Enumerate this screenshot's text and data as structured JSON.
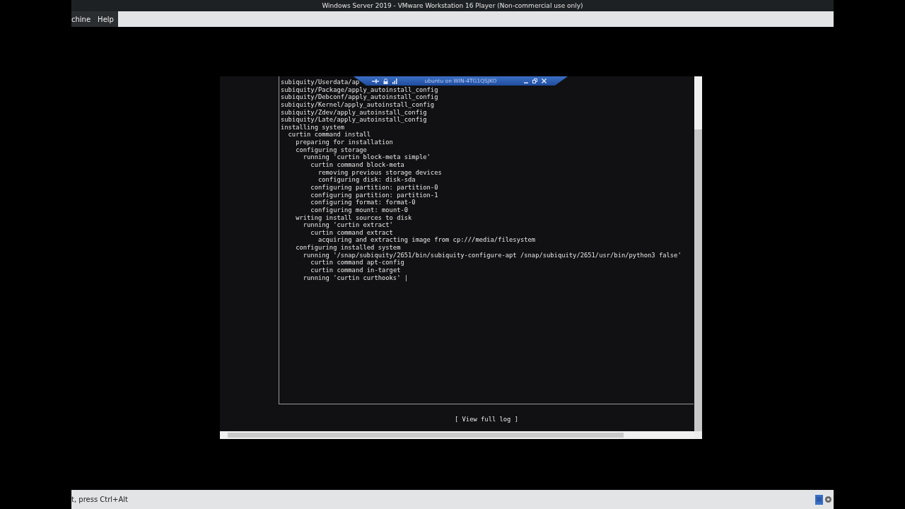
{
  "window": {
    "title": "Windows Server 2019 - VMware Workstation 16 Player (Non-commercial use only)"
  },
  "menu": [
    "chine",
    "Help"
  ],
  "console_bar": {
    "title": "ubuntu on WIN-4TG1QSJKO"
  },
  "log": [
    {
      "text": "subiquity/Userdata/ap"
    },
    {
      "text": "subiquity/Package/apply_autoinstall_config"
    },
    {
      "text": "subiquity/Debconf/apply_autoinstall_config"
    },
    {
      "text": "subiquity/Kernel/apply_autoinstall_config"
    },
    {
      "text": "subiquity/Zdev/apply_autoinstall_config"
    },
    {
      "text": "subiquity/Late/apply_autoinstall_config"
    },
    {
      "text": "installing system",
      "children": [
        {
          "text": "curtin command install",
          "children": [
            {
              "text": "preparing for installation"
            },
            {
              "text": "configuring storage",
              "children": [
                {
                  "text": "running 'curtin block-meta simple'",
                  "children": [
                    {
                      "text": "curtin command block-meta",
                      "children": [
                        {
                          "text": "removing previous storage devices"
                        },
                        {
                          "text": "configuring disk: disk-sda"
                        }
                      ]
                    },
                    {
                      "text": "configuring partition: partition-0"
                    },
                    {
                      "text": "configuring partition: partition-1"
                    },
                    {
                      "text": "configuring format: format-0"
                    },
                    {
                      "text": "configuring mount: mount-0"
                    }
                  ]
                }
              ]
            },
            {
              "text": "writing install sources to disk",
              "children": [
                {
                  "text": "running 'curtin extract'",
                  "children": [
                    {
                      "text": "curtin command extract",
                      "children": [
                        {
                          "text": "acquiring and extracting image from cp:///media/filesystem"
                        }
                      ]
                    }
                  ]
                }
              ]
            },
            {
              "text": "configuring installed system",
              "children": [
                {
                  "text": "running '/snap/subiquity/2651/bin/subiquity-configure-apt /snap/subiquity/2651/usr/bin/python3 false'",
                  "children": [
                    {
                      "text": "curtin command apt-config"
                    },
                    {
                      "text": "curtin command in-target"
                    }
                  ]
                },
                {
                  "text": "running 'curtin curthooks' |"
                }
              ]
            }
          ]
        }
      ]
    }
  ],
  "view_log_button": "[ View full log ]",
  "status_bar": {
    "text": "t, press Ctrl+Alt"
  }
}
